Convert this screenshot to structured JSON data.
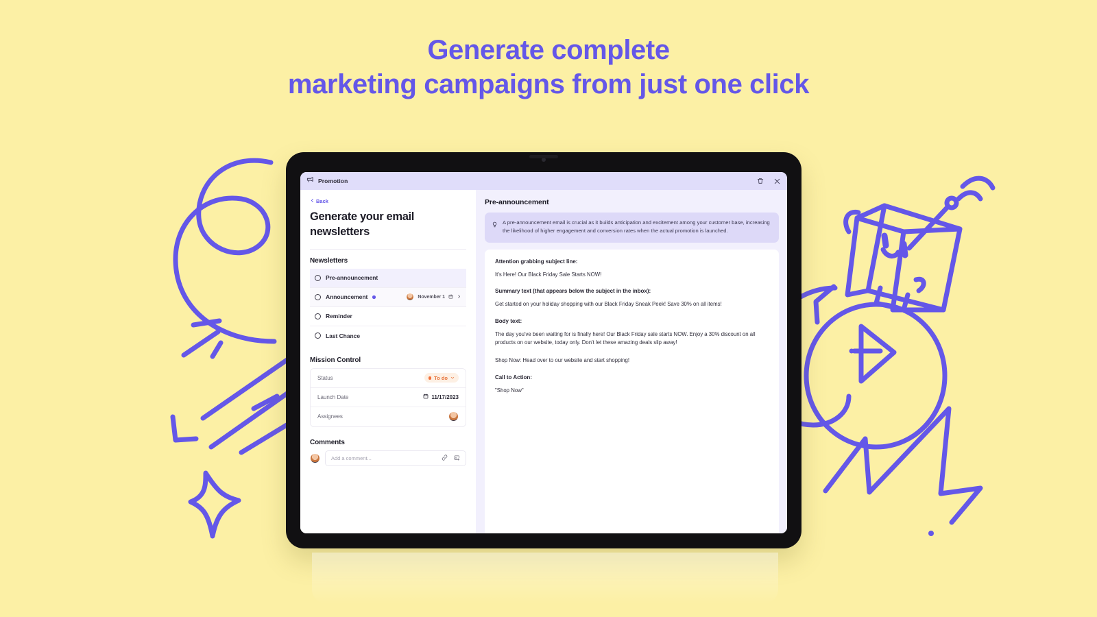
{
  "headline": {
    "line1": "Generate complete",
    "line2": "marketing campaigns from just one click",
    "color": "#6457e8"
  },
  "theme": {
    "background": "#fcf0a5",
    "accent": "#6457e8",
    "panel_bg": "#f2f0fd",
    "header_bg": "#e0ddfa",
    "tip_bg": "#ddd9f8",
    "status_color": "#f4703a"
  },
  "app": {
    "header": {
      "icon": "megaphone-icon",
      "title": "Promotion",
      "actions": [
        {
          "name": "delete-button",
          "icon": "trash-icon"
        },
        {
          "name": "close-button",
          "icon": "close-icon"
        }
      ]
    },
    "sidebar": {
      "back_label": "Back",
      "page_title": "Generate your email newsletters",
      "newsletters_heading": "Newsletters",
      "newsletters": [
        {
          "label": "Pre-announcement",
          "selected": true,
          "has_dot": false,
          "date": "",
          "has_avatar": false
        },
        {
          "label": "Announcement",
          "selected": false,
          "has_dot": true,
          "date": "November 1",
          "has_avatar": true
        },
        {
          "label": "Reminder",
          "selected": false,
          "has_dot": false,
          "date": "",
          "has_avatar": false
        },
        {
          "label": "Last Chance",
          "selected": false,
          "has_dot": false,
          "date": "",
          "has_avatar": false
        }
      ],
      "mission_control_heading": "Mission Control",
      "mission_control": {
        "status_label": "Status",
        "status_value": "To do",
        "launch_date_label": "Launch Date",
        "launch_date_value": "11/17/2023",
        "assignees_label": "Assignees"
      },
      "comments_heading": "Comments",
      "comment_placeholder": "Add a comment..."
    },
    "main": {
      "title": "Pre-announcement",
      "tip": "A pre-announcement email is crucial as it builds anticipation and excitement among your customer base, increasing the likelihood of higher engagement and conversion rates when the actual promotion is launched.",
      "blocks": [
        {
          "heading": "Attention grabbing subject line:",
          "body": "It's Here! Our Black Friday Sale Starts NOW!"
        },
        {
          "heading": "Summary text (that appears below the subject in the inbox):",
          "body": "Get started on your holiday shopping with our Black Friday Sneak Peek! Save 30% on all items!"
        },
        {
          "heading": "Body text:",
          "body": "The day you've been waiting for is finally here! Our Black Friday sale starts NOW. Enjoy a 30% discount on all products on our website, today only. Don't let these amazing deals slip away!"
        },
        {
          "heading": "",
          "body": "Shop Now: Head over to our website and start shopping!"
        },
        {
          "heading": "Call to Action:",
          "body": "\"Shop Now\""
        }
      ]
    }
  }
}
